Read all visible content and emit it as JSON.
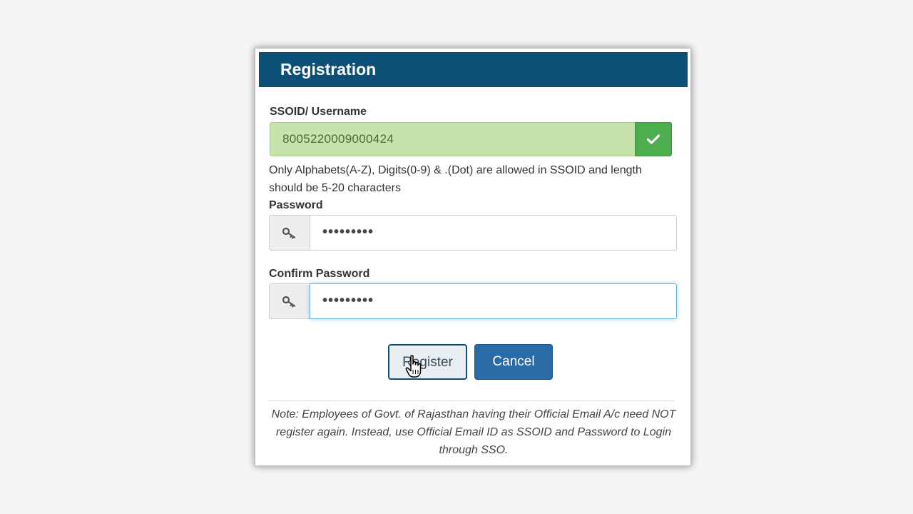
{
  "dialog": {
    "title": "Registration"
  },
  "ssoid": {
    "label": "SSOID/ Username",
    "value": "8005220009000424",
    "valid_icon": "check-icon",
    "hint": "Only Alphabets(A-Z), Digits(0-9) & .(Dot) are allowed in SSOID and length should be 5-20 characters"
  },
  "password": {
    "label": "Password",
    "value": "•••••••••",
    "icon": "key-icon"
  },
  "confirm_password": {
    "label": "Confirm Password",
    "value": "•••••••••",
    "icon": "key-icon"
  },
  "buttons": {
    "register": "Register",
    "cancel": "Cancel"
  },
  "note": "Note: Employees of Govt. of Rajasthan having their Official Email A/c need NOT register again. Instead, use Official Email ID as SSOID and Password to Login through SSO.",
  "colors": {
    "header": "#0d5077",
    "valid_field": "#c6e3ad",
    "valid_button": "#4cae4c",
    "cancel_button": "#2a6aa6"
  }
}
